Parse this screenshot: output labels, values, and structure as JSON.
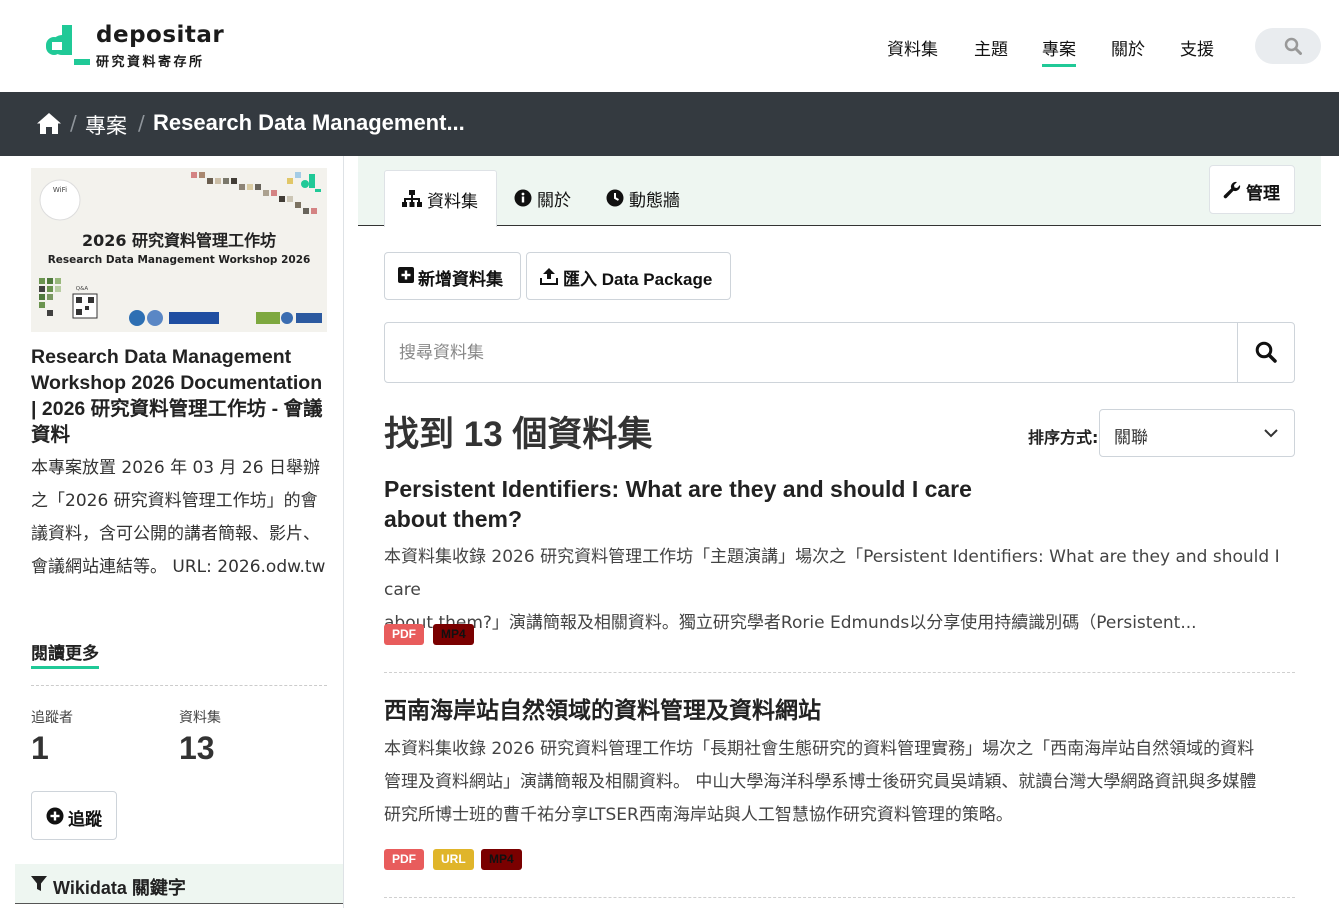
{
  "header": {
    "logo_word": "depositar",
    "logo_sub": "研究資料寄存所",
    "nav": [
      {
        "label": "資料集"
      },
      {
        "label": "主題"
      },
      {
        "label": "專案"
      },
      {
        "label": "關於"
      },
      {
        "label": "支援"
      }
    ],
    "accent_color": "#20c997"
  },
  "breadcrumb": {
    "items": [
      "專案",
      "Research Data Management..."
    ]
  },
  "sidebar": {
    "image": {
      "wifi": "WiFi",
      "title_zh": "2026 研究資料管理工作坊",
      "title_en": "Research Data Management Workshop 2026",
      "qa": "Q&A"
    },
    "title": "Research Data Management Workshop 2026 Documentation | 2026 研究資料管理工作坊 - 會議資料",
    "description": "本專案放置 2026 年 03 月 26 日舉辦之「2026 研究資料管理工作坊」的會議資料，含可公開的講者簡報、影片、會議網站連結等。 URL: 2026.odw.tw",
    "read_more": "閱讀更多",
    "followers_label": "追蹤者",
    "followers_value": "1",
    "datasets_label": "資料集",
    "datasets_value": "13",
    "follow_button": "追蹤",
    "wikidata_heading": "Wikidata 關鍵字"
  },
  "main": {
    "tabs": [
      {
        "label": "資料集"
      },
      {
        "label": "關於"
      },
      {
        "label": "動態牆"
      }
    ],
    "manage_button": "管理",
    "add_dataset_button": "新增資料集",
    "import_button": "匯入 Data Package",
    "search_placeholder": "搜尋資料集",
    "found_text": "找到 13 個資料集",
    "sort_label": "排序方式:",
    "sort_value": "關聯",
    "datasets": [
      {
        "title_line1": "Persistent Identifiers: What are they and should I care",
        "title_line2": "about them?",
        "desc_line1": "本資料集收錄 2026 研究資料管理工作坊「主題演講」場次之「Persistent Identifiers: What are they and should I care",
        "desc_line2": "about them?」演講簡報及相關資料。獨立研究學者Rorie Edmunds以分享使用持續識別碼（Persistent...",
        "formats": [
          "PDF",
          "MP4"
        ]
      },
      {
        "title_line1": "西南海岸站自然領域的資料管理及資料網站",
        "desc_line1": "本資料集收錄 2026 研究資料管理工作坊「長期社會生態研究的資料管理實務」場次之「西南海岸站自然領域的資料",
        "desc_line2": "管理及資料網站」演講簡報及相關資料。 中山大學海洋科學系博士後研究員吳靖穎、就讀台灣大學網路資訊與多媒體",
        "desc_line3": "研究所博士班的曹千祐分享LTSER西南海岸站與人工智慧協作研究資料管理的策略。",
        "formats": [
          "PDF",
          "URL",
          "MP4"
        ]
      }
    ]
  }
}
